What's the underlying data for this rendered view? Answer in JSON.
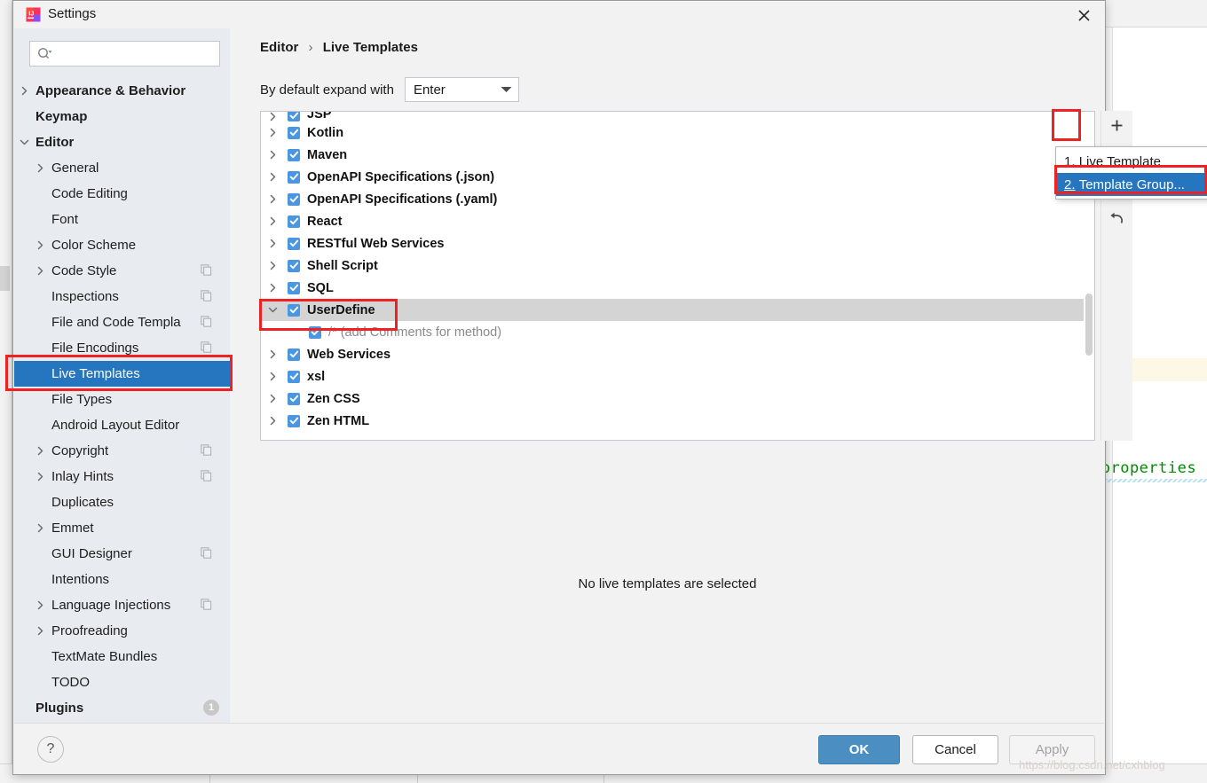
{
  "window": {
    "title": "Settings",
    "app_icon": "intellij-idea-icon",
    "close_icon": "close-icon"
  },
  "search": {
    "placeholder": "",
    "value": "",
    "icon": "search-icon"
  },
  "sidebar": {
    "items": [
      {
        "label": "Appearance & Behavior",
        "arrow": "chevron-right",
        "indent": 0,
        "bold": true,
        "selected": false,
        "copy": false
      },
      {
        "label": "Keymap",
        "arrow": "",
        "indent": 0,
        "bold": true,
        "selected": false,
        "copy": false
      },
      {
        "label": "Editor",
        "arrow": "chevron-down",
        "indent": 0,
        "bold": true,
        "selected": false,
        "copy": false
      },
      {
        "label": "General",
        "arrow": "chevron-right",
        "indent": 1,
        "bold": false,
        "selected": false,
        "copy": false
      },
      {
        "label": "Code Editing",
        "arrow": "",
        "indent": 1,
        "bold": false,
        "selected": false,
        "copy": false
      },
      {
        "label": "Font",
        "arrow": "",
        "indent": 1,
        "bold": false,
        "selected": false,
        "copy": false
      },
      {
        "label": "Color Scheme",
        "arrow": "chevron-right",
        "indent": 1,
        "bold": false,
        "selected": false,
        "copy": false
      },
      {
        "label": "Code Style",
        "arrow": "chevron-right",
        "indent": 1,
        "bold": false,
        "selected": false,
        "copy": true
      },
      {
        "label": "Inspections",
        "arrow": "",
        "indent": 1,
        "bold": false,
        "selected": false,
        "copy": true
      },
      {
        "label": "File and Code Templa",
        "arrow": "",
        "indent": 1,
        "bold": false,
        "selected": false,
        "copy": true
      },
      {
        "label": "File Encodings",
        "arrow": "",
        "indent": 1,
        "bold": false,
        "selected": false,
        "copy": true
      },
      {
        "label": "Live Templates",
        "arrow": "",
        "indent": 1,
        "bold": false,
        "selected": true,
        "copy": false
      },
      {
        "label": "File Types",
        "arrow": "",
        "indent": 1,
        "bold": false,
        "selected": false,
        "copy": false
      },
      {
        "label": "Android Layout Editor",
        "arrow": "",
        "indent": 1,
        "bold": false,
        "selected": false,
        "copy": false
      },
      {
        "label": "Copyright",
        "arrow": "chevron-right",
        "indent": 1,
        "bold": false,
        "selected": false,
        "copy": true
      },
      {
        "label": "Inlay Hints",
        "arrow": "chevron-right",
        "indent": 1,
        "bold": false,
        "selected": false,
        "copy": true
      },
      {
        "label": "Duplicates",
        "arrow": "",
        "indent": 1,
        "bold": false,
        "selected": false,
        "copy": false
      },
      {
        "label": "Emmet",
        "arrow": "chevron-right",
        "indent": 1,
        "bold": false,
        "selected": false,
        "copy": false
      },
      {
        "label": "GUI Designer",
        "arrow": "",
        "indent": 1,
        "bold": false,
        "selected": false,
        "copy": true
      },
      {
        "label": "Intentions",
        "arrow": "",
        "indent": 1,
        "bold": false,
        "selected": false,
        "copy": false
      },
      {
        "label": "Language Injections",
        "arrow": "chevron-right",
        "indent": 1,
        "bold": false,
        "selected": false,
        "copy": true
      },
      {
        "label": "Proofreading",
        "arrow": "chevron-right",
        "indent": 1,
        "bold": false,
        "selected": false,
        "copy": false
      },
      {
        "label": "TextMate Bundles",
        "arrow": "",
        "indent": 1,
        "bold": false,
        "selected": false,
        "copy": false
      },
      {
        "label": "TODO",
        "arrow": "",
        "indent": 1,
        "bold": false,
        "selected": false,
        "copy": false
      },
      {
        "label": "Plugins",
        "arrow": "",
        "indent": 0,
        "bold": true,
        "selected": false,
        "copy": false,
        "badge": "1"
      }
    ]
  },
  "breadcrumb": {
    "root": "Editor",
    "separator": "›",
    "current": "Live Templates"
  },
  "expand_with": {
    "label": "By default expand with",
    "value": "Enter",
    "caret_icon": "chevron-down-icon"
  },
  "templates": {
    "rows": [
      {
        "name": "JSP",
        "arrow": "chevron-right",
        "checked": true,
        "child": false,
        "selected": false,
        "partial": true
      },
      {
        "name": "Kotlin",
        "arrow": "chevron-right",
        "checked": true,
        "child": false,
        "selected": false
      },
      {
        "name": "Maven",
        "arrow": "chevron-right",
        "checked": true,
        "child": false,
        "selected": false
      },
      {
        "name": "OpenAPI Specifications (.json)",
        "arrow": "chevron-right",
        "checked": true,
        "child": false,
        "selected": false
      },
      {
        "name": "OpenAPI Specifications (.yaml)",
        "arrow": "chevron-right",
        "checked": true,
        "child": false,
        "selected": false
      },
      {
        "name": "React",
        "arrow": "chevron-right",
        "checked": true,
        "child": false,
        "selected": false
      },
      {
        "name": "RESTful Web Services",
        "arrow": "chevron-right",
        "checked": true,
        "child": false,
        "selected": false
      },
      {
        "name": "Shell Script",
        "arrow": "chevron-right",
        "checked": true,
        "child": false,
        "selected": false
      },
      {
        "name": "SQL",
        "arrow": "chevron-right",
        "checked": true,
        "child": false,
        "selected": false
      },
      {
        "name": "UserDefine",
        "arrow": "chevron-down",
        "checked": true,
        "child": false,
        "selected": true
      },
      {
        "name": "/* (add Comments for method)",
        "arrow": "",
        "checked": true,
        "child": true,
        "selected": false
      },
      {
        "name": "Web Services",
        "arrow": "chevron-right",
        "checked": true,
        "child": false,
        "selected": false
      },
      {
        "name": "xsl",
        "arrow": "chevron-right",
        "checked": true,
        "child": false,
        "selected": false
      },
      {
        "name": "Zen CSS",
        "arrow": "chevron-right",
        "checked": true,
        "child": false,
        "selected": false
      },
      {
        "name": "Zen HTML",
        "arrow": "chevron-right",
        "checked": true,
        "child": false,
        "selected": false
      }
    ],
    "empty_message": "No live templates are selected"
  },
  "toolbar": {
    "add_label": "+",
    "add_icon": "plus-icon",
    "revert_icon": "revert-arrow-icon"
  },
  "add_menu": {
    "items": [
      {
        "num": "1.",
        "label": "Live Template",
        "active": false
      },
      {
        "num": "2.",
        "label": "Template Group...",
        "active": true
      }
    ]
  },
  "footer": {
    "help_icon": "question-mark-icon",
    "ok": "OK",
    "cancel": "Cancel",
    "apply": "Apply"
  },
  "background": {
    "code_text": ".properties"
  },
  "watermark": "https://blog.csdn.net/cxhblog",
  "colors": {
    "accent_blue": "#2675bf",
    "button_blue": "#4a8ec2",
    "checkbox_blue": "#4a96e2",
    "annotation_red": "#ee2222",
    "sidebar_bg": "#e8ecf0",
    "dialog_bg": "#f2f2f2",
    "code_green": "#008a00"
  }
}
